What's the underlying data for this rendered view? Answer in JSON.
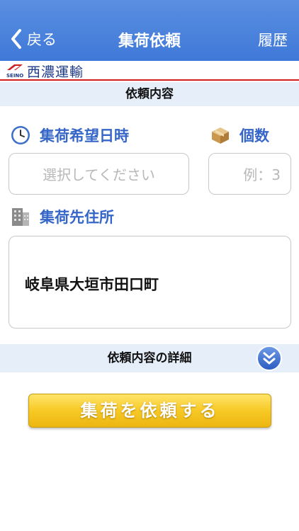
{
  "nav": {
    "back_label": "戻る",
    "title": "集荷依頼",
    "history_label": "履歴"
  },
  "brand": {
    "logo_text": "SEINO",
    "name": "西濃運輸"
  },
  "section1": {
    "title": "依頼内容"
  },
  "pickup_datetime": {
    "label": "集荷希望日時",
    "placeholder": "選択してください"
  },
  "quantity": {
    "label": "個数",
    "placeholder": "例：3"
  },
  "pickup_address": {
    "label": "集荷先住所",
    "value": "岐阜県大垣市田口町"
  },
  "section2": {
    "title": "依頼内容の詳細"
  },
  "submit": {
    "label": "集荷を依頼する"
  },
  "colors": {
    "nav_bar": "#4a83dc",
    "label_text": "#3566c8",
    "section_bg": "#e6eefa",
    "button": "#f7c926",
    "brand_line": "#d01e1e"
  },
  "icons": [
    "chevron-left-icon",
    "clock-icon",
    "box-icon",
    "building-icon",
    "chevron-double-down-icon"
  ]
}
